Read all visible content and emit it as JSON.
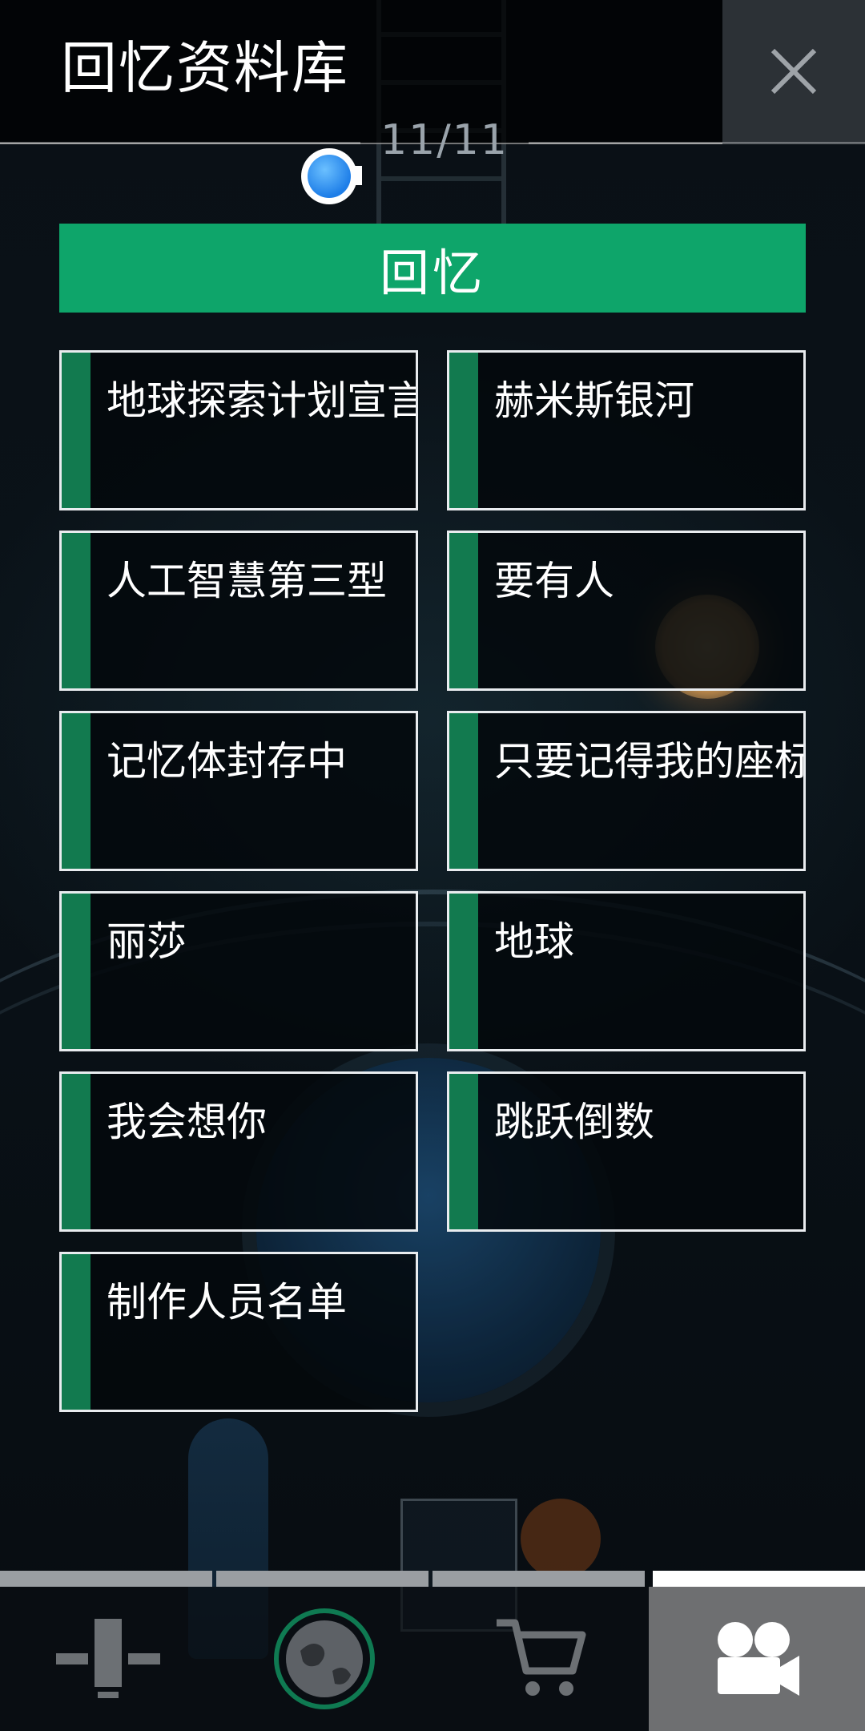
{
  "header": {
    "title": "回忆资料库",
    "close_icon": "close-icon",
    "counter": "11/11"
  },
  "category": {
    "label": "回忆"
  },
  "memories": [
    {
      "label": "地球探索计划宣言"
    },
    {
      "label": "赫米斯银河"
    },
    {
      "label": "人工智慧第三型"
    },
    {
      "label": "要有人"
    },
    {
      "label": "记忆体封存中"
    },
    {
      "label": "只要记得我的座标"
    },
    {
      "label": "丽莎"
    },
    {
      "label": "地球"
    },
    {
      "label": "我会想你"
    },
    {
      "label": "跳跃倒数"
    },
    {
      "label": "制作人员名单"
    }
  ],
  "nav": {
    "tabs": [
      {
        "icon": "station-icon"
      },
      {
        "icon": "planet-icon"
      },
      {
        "icon": "cart-icon"
      },
      {
        "icon": "video-camera-icon",
        "active": true
      }
    ]
  },
  "colors": {
    "accent_green": "#0ea56a",
    "stripe_green": "#127a4f",
    "active_tab": "#6e6f71"
  }
}
